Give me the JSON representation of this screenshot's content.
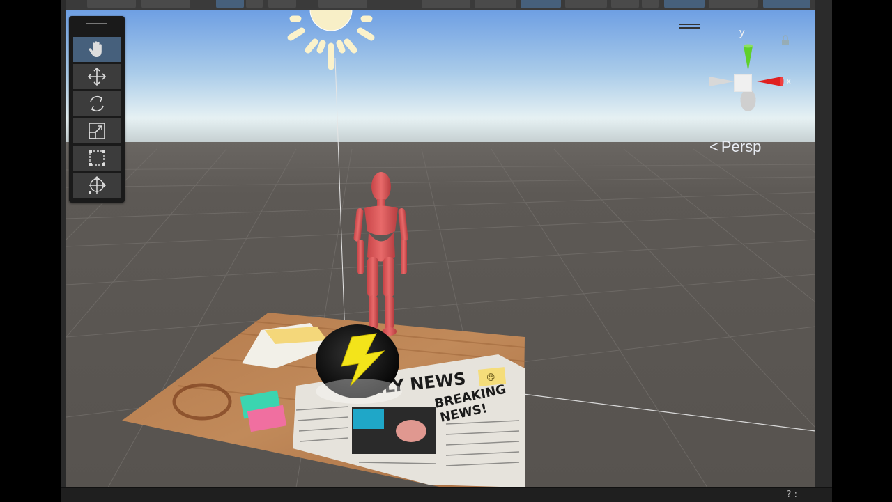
{
  "scene": {
    "projection_label": "Persp",
    "gizmo_labels": {
      "x": "x",
      "y": "y"
    },
    "newspaper": {
      "masthead": "DAILY NEWS",
      "headline_line1": "BREAKING",
      "headline_line2": "NEWS!"
    }
  },
  "tools": [
    {
      "name": "hand-tool",
      "icon": "hand-icon",
      "active": true
    },
    {
      "name": "move-tool",
      "icon": "move-icon",
      "active": false
    },
    {
      "name": "rotate-tool",
      "icon": "rotate-icon",
      "active": false
    },
    {
      "name": "scale-tool",
      "icon": "scale-icon",
      "active": false
    },
    {
      "name": "rect-tool",
      "icon": "rect-transform-icon",
      "active": false
    },
    {
      "name": "transform-tool",
      "icon": "transform-icon",
      "active": false
    }
  ],
  "colors": {
    "sky_top": "#6e9fe3",
    "horizon": "#e6f1f3",
    "ground": "#5b5753",
    "active_tool": "#46607c",
    "character": "#e0585a",
    "gizmo_x": "#e02020",
    "gizmo_y": "#5fd02a"
  },
  "bottom_bar": {
    "glyph": "? :"
  }
}
